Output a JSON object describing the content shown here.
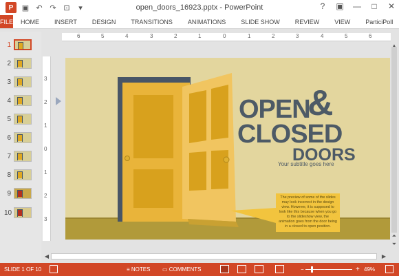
{
  "window": {
    "title": "open_doors_16923.pptx - PowerPoint",
    "controls": [
      "?",
      "▣",
      "—",
      "□",
      "✕"
    ]
  },
  "qat": {
    "app_icon_label": "P"
  },
  "ribbon": {
    "tabs": [
      "FILE",
      "HOME",
      "INSERT",
      "DESIGN",
      "TRANSITIONS",
      "ANIMATIONS",
      "SLIDE SHOW",
      "REVIEW",
      "VIEW",
      "ParticiPoll"
    ]
  },
  "ruler": {
    "h_labels": [
      "6",
      "5",
      "4",
      "3",
      "2",
      "1",
      "0",
      "1",
      "2",
      "3",
      "4",
      "5",
      "6"
    ],
    "v_labels": [
      "3",
      "2",
      "1",
      "0",
      "1",
      "2",
      "3"
    ]
  },
  "thumbnails": {
    "numbers": [
      "1",
      "2",
      "3",
      "4",
      "5",
      "6",
      "7",
      "8",
      "9",
      "10"
    ]
  },
  "slide": {
    "title_line1": "OPEN",
    "ampersand": "&",
    "title_line2": "CLOSED",
    "title_line3": "DOORS",
    "subtitle": "Your subtitle goes here",
    "note": "The preview of some of the slides may look incorrect in the design view. However, it is supposed to look like this because when you go to the slideshow view, the animation goes from the door being in a closed to open position.",
    "colors": {
      "background": "#e3d69e",
      "door": "#e9b43a",
      "frame": "#485566",
      "floor": "#b19a3a",
      "text": "#4d5a66"
    }
  },
  "status": {
    "slide_info": "SLIDE 1 OF 10",
    "notes": "NOTES",
    "comments": "COMMENTS",
    "zoom_percent": "49%",
    "accent": "#d24726"
  }
}
